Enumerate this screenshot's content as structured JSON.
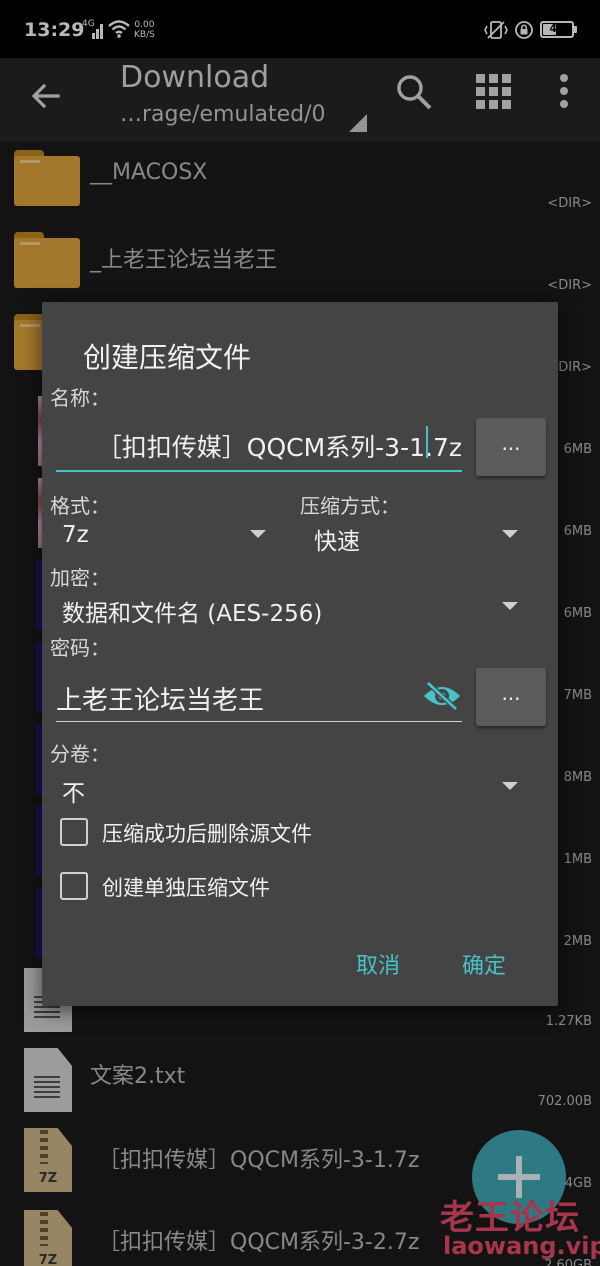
{
  "status_bar": {
    "time": "13:29",
    "network_type": "4G",
    "speed_value": "0.00",
    "speed_unit": "KB/S",
    "battery": "47",
    "battery_level": 0.47
  },
  "toolbar": {
    "title": "Download",
    "path": "…rage/emulated/0",
    "icons": [
      "back-arrow-icon",
      "search-icon",
      "grid-view-icon",
      "more-vert-icon"
    ]
  },
  "files": [
    {
      "name": "__MACOSX",
      "size": "<DIR>",
      "icon": "folder"
    },
    {
      "name": "_上老王论坛当老王",
      "size": "<DIR>",
      "icon": "folder"
    },
    {
      "name": "",
      "size": "<DIR>",
      "icon": "folder"
    },
    {
      "name": "",
      "size": "6MB",
      "icon": "image"
    },
    {
      "name": "",
      "size": "6MB",
      "icon": "image"
    },
    {
      "name": "",
      "size": "6MB",
      "icon": "video"
    },
    {
      "name": "",
      "size": "7MB",
      "icon": "video"
    },
    {
      "name": "",
      "size": "8MB",
      "icon": "video"
    },
    {
      "name": "",
      "size": "1MB",
      "icon": "video"
    },
    {
      "name": "",
      "size": "2MB",
      "icon": "video"
    },
    {
      "name": "",
      "size": "1.27KB",
      "icon": "document"
    },
    {
      "name": "文案2.txt",
      "size": "702.00B",
      "icon": "document"
    },
    {
      "name": "［扣扣传媒］QQCM系列-3-1.7z",
      "size": "4GB",
      "icon": "archive"
    },
    {
      "name": "［扣扣传媒］QQCM系列-3-2.7z",
      "size": "2.60GB",
      "icon": "archive"
    }
  ],
  "archive_ext": "7Z",
  "dialog": {
    "title": "创建压缩文件",
    "name_label": "名称：",
    "name_value": "［扣扣传媒］QQCM系列-3-1.7z",
    "browse_label": "...",
    "format_label": "格式：",
    "format_value": "7z",
    "method_label": "压缩方式：",
    "method_value": "快速",
    "encryption_label": "加密：",
    "encryption_value": "数据和文件名 (AES-256)",
    "password_label": "密码：",
    "password_value": "上老王论坛当老王",
    "split_label": "分卷：",
    "split_value": "不",
    "delete_source_label": "压缩成功后删除源文件",
    "delete_source_checked": false,
    "separate_archives_label": "创建单独压缩文件",
    "separate_archives_checked": false,
    "cancel_label": "取消",
    "ok_label": "确定"
  },
  "watermark": {
    "title": "老王论坛",
    "url": "laowang.vip"
  },
  "colors": {
    "accent": "#46c3c9",
    "dialog_bg": "#444444",
    "fab": "#40a9b4",
    "watermark": "#e84a6a",
    "folder": "#e3a73d"
  }
}
